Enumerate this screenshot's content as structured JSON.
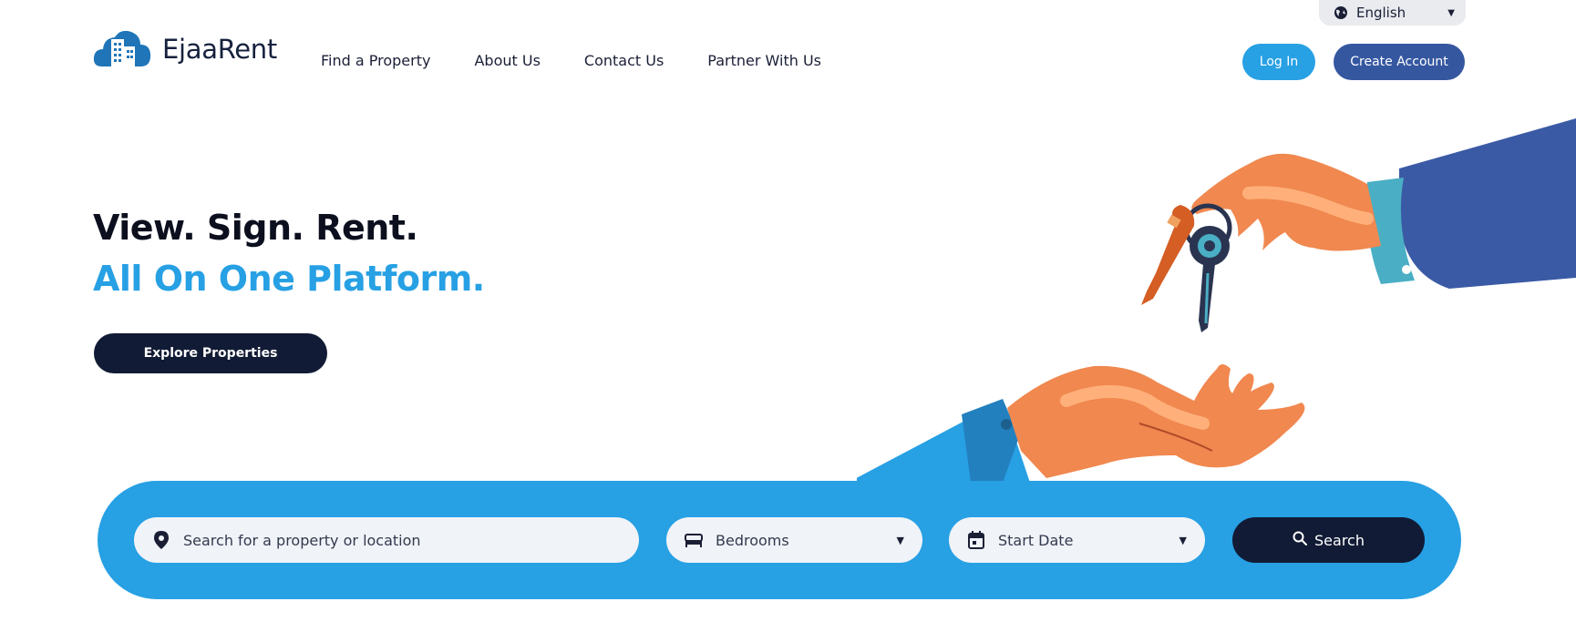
{
  "language": {
    "selected": "English"
  },
  "brand": {
    "name": "EjaaRent"
  },
  "nav": {
    "items": [
      {
        "label": "Find a Property"
      },
      {
        "label": "About Us"
      },
      {
        "label": "Contact Us"
      },
      {
        "label": "Partner With Us"
      }
    ]
  },
  "auth": {
    "login_label": "Log In",
    "create_label": "Create Account"
  },
  "hero": {
    "line1": "View. Sign. Rent.",
    "line2": "All On One Platform.",
    "cta_label": "Explore Properties"
  },
  "search": {
    "location_placeholder": "Search for a property or location",
    "bedrooms_label": "Bedrooms",
    "date_label": "Start Date",
    "button_label": "Search"
  },
  "colors": {
    "accent_blue": "#27a0e4",
    "navy": "#121b35",
    "create_button": "#3557a0",
    "field_bg": "#f0f3f8"
  },
  "icons": [
    "globe-icon",
    "logo-building-cloud-icon",
    "location-pin-icon",
    "bed-icon",
    "calendar-icon",
    "search-icon",
    "chevron-down-icon"
  ]
}
